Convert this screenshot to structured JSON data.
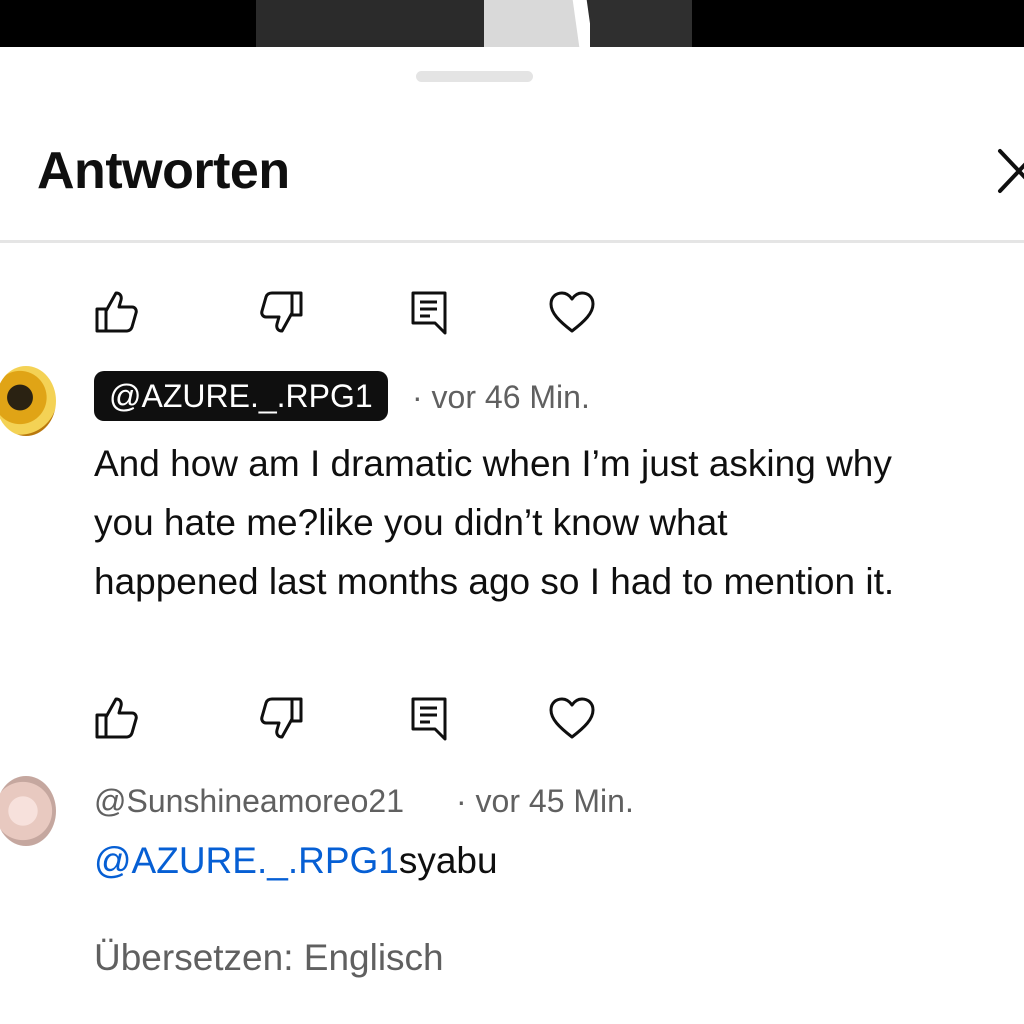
{
  "sheet": {
    "title": "Antworten"
  },
  "comments": [
    {
      "handle": "@AZURE._.RPG1",
      "time": "vor 46 Min.",
      "text": "And how am I dramatic when I’m just asking why\nyou hate me?like you didn’t know what\nhappened last months ago so I had to mention it."
    },
    {
      "handle": "@Sunshineamoreo21",
      "time": "vor 45 Min.",
      "mention": "@AZURE._.RPG1",
      "text": "syabu",
      "translate": "Übersetzen: Englisch"
    }
  ],
  "icons": [
    "thumbs-up-icon",
    "thumbs-down-icon",
    "reply-icon",
    "heart-icon",
    "close-icon"
  ],
  "colors": {
    "mention": "#065fd4",
    "meta": "#606060",
    "chip": "#0f0f0f"
  }
}
